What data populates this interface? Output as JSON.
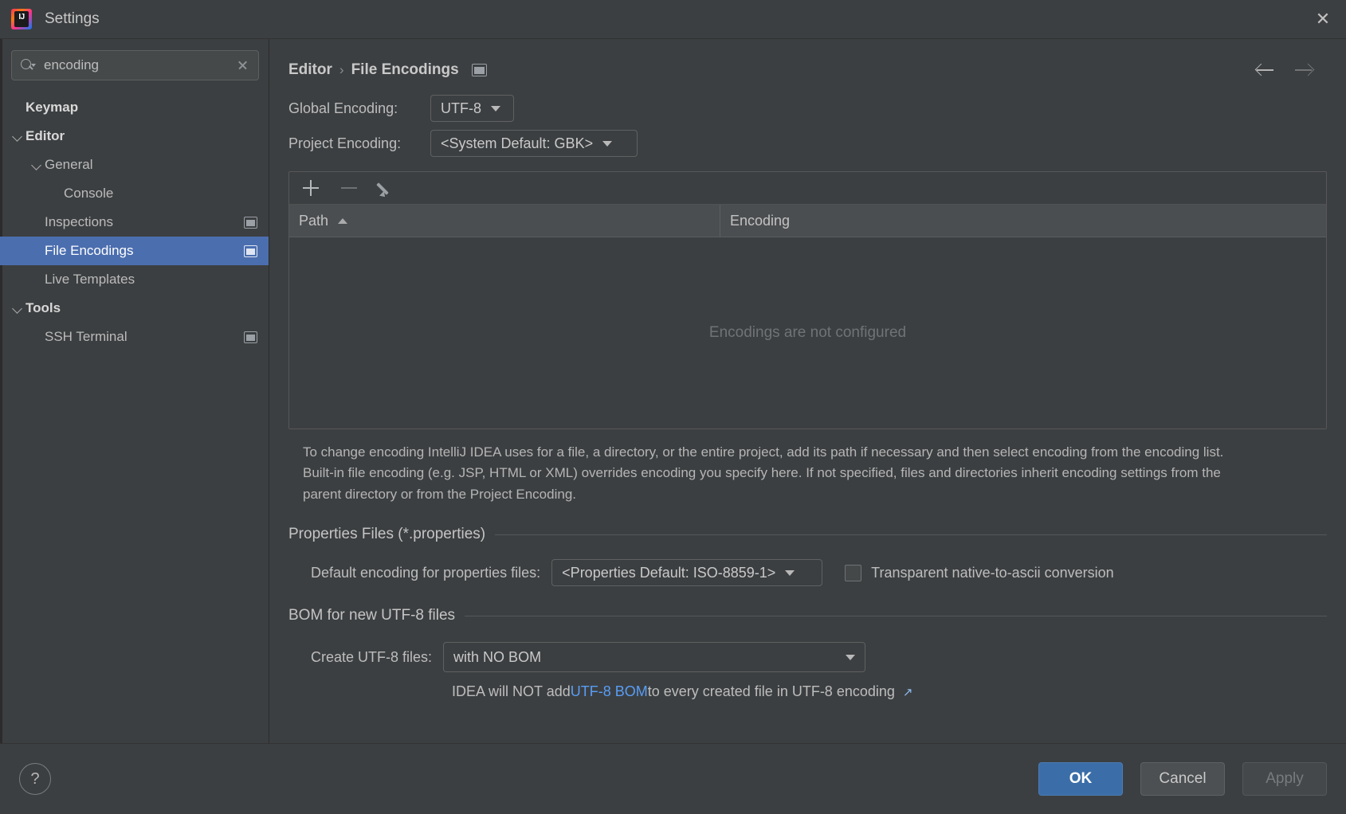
{
  "window": {
    "title": "Settings",
    "logo_icon": "intellij-idea-logo",
    "close_icon": "close-icon"
  },
  "sidebar": {
    "search": {
      "value": "encoding",
      "placeholder": "Search settings",
      "icon": "search-icon",
      "clear_icon": "clear-icon"
    },
    "items": [
      {
        "label": "Keymap",
        "indent": 0,
        "bold": true,
        "twisty": "none",
        "selected": false,
        "badge": false
      },
      {
        "label": "Editor",
        "indent": 0,
        "bold": true,
        "twisty": "open",
        "selected": false,
        "badge": false
      },
      {
        "label": "General",
        "indent": 1,
        "bold": false,
        "twisty": "open",
        "selected": false,
        "badge": false
      },
      {
        "label": "Console",
        "indent": 2,
        "bold": false,
        "twisty": "none",
        "selected": false,
        "badge": false
      },
      {
        "label": "Inspections",
        "indent": 1,
        "bold": false,
        "twisty": "none",
        "selected": false,
        "badge": true
      },
      {
        "label": "File Encodings",
        "indent": 1,
        "bold": false,
        "twisty": "none",
        "selected": true,
        "badge": true
      },
      {
        "label": "Live Templates",
        "indent": 1,
        "bold": false,
        "twisty": "none",
        "selected": false,
        "badge": false
      },
      {
        "label": "Tools",
        "indent": 0,
        "bold": true,
        "twisty": "open",
        "selected": false,
        "badge": false
      },
      {
        "label": "SSH Terminal",
        "indent": 1,
        "bold": false,
        "twisty": "none",
        "selected": false,
        "badge": true
      }
    ]
  },
  "breadcrumb": {
    "parent": "Editor",
    "separator": "›",
    "current": "File Encodings",
    "badge_icon": "project-scope-icon",
    "back_icon": "arrow-left-icon",
    "forward_icon": "arrow-right-icon"
  },
  "encodings": {
    "global_label": "Global Encoding:",
    "global_value": "UTF-8",
    "project_label": "Project Encoding:",
    "project_value": "<System Default: GBK>",
    "toolbar": {
      "add_icon": "plus-icon",
      "remove_icon": "minus-icon",
      "edit_icon": "pencil-icon"
    },
    "columns": [
      "Path",
      "Encoding"
    ],
    "sort_indicator": "sort-ascending-icon",
    "rows": [],
    "empty_message": "Encodings are not configured",
    "description": "To change encoding IntelliJ IDEA uses for a file, a directory, or the entire project, add its path if necessary and then select encoding from the encoding list. Built-in file encoding (e.g. JSP, HTML or XML) overrides encoding you specify here. If not specified, files and directories inherit encoding settings from the parent directory or from the Project Encoding."
  },
  "properties_section": {
    "title": "Properties Files (*.properties)",
    "default_encoding_label": "Default encoding for properties files:",
    "default_encoding_value": "<Properties Default: ISO-8859-1>",
    "transparent_checkbox_label": "Transparent native-to-ascii conversion",
    "transparent_checked": false
  },
  "bom_section": {
    "title": "BOM for new UTF-8 files",
    "create_label": "Create UTF-8 files:",
    "create_value": "with NO BOM",
    "hint_prefix": "IDEA will NOT add ",
    "hint_link": "UTF-8 BOM",
    "hint_suffix": " to every created file in UTF-8 encoding",
    "external_link_icon": "↗"
  },
  "footer": {
    "help_label": "?",
    "ok_label": "OK",
    "cancel_label": "Cancel",
    "apply_label": "Apply",
    "apply_disabled": true
  },
  "colors": {
    "background": "#3c3f41",
    "selection": "#4b6eaf",
    "primary_button": "#3b6ea8",
    "link": "#589df6",
    "muted_text": "#6f7376"
  }
}
